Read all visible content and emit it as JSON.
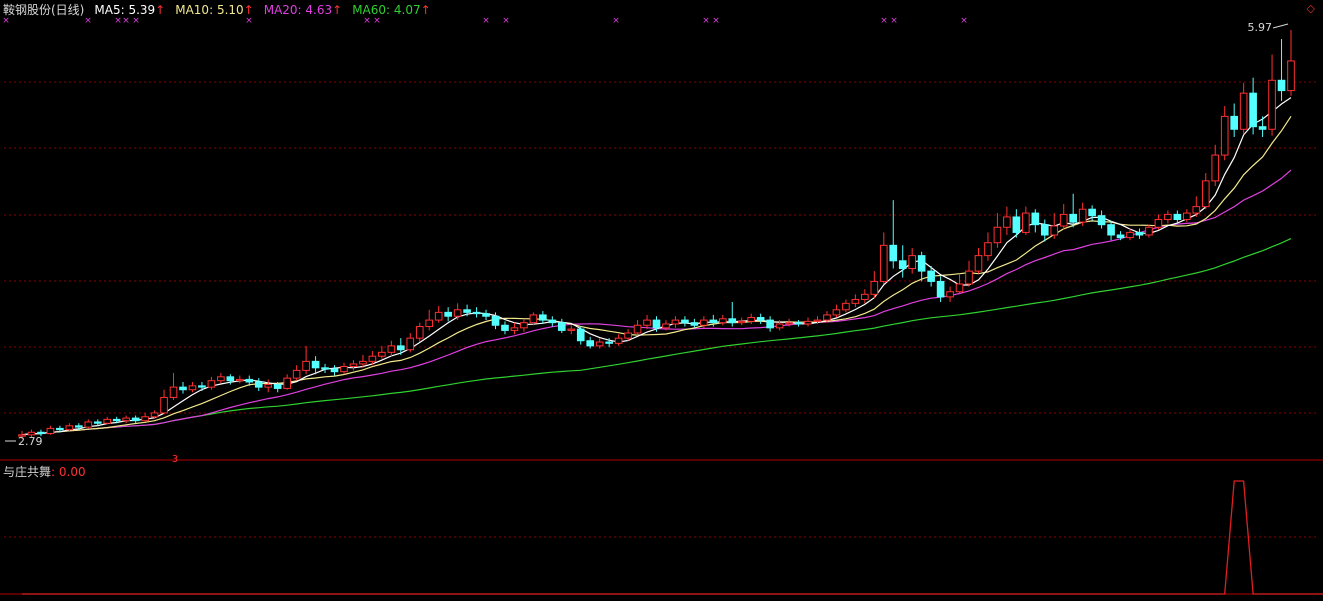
{
  "header": {
    "title": "鞍钢股份(日线)",
    "ma5": {
      "label": "MA5:",
      "value": "5.39",
      "arrow": "↑",
      "color": "#ffffff"
    },
    "ma10": {
      "label": "MA10:",
      "value": "5.10",
      "arrow": "↑",
      "color": "#f2e88c"
    },
    "ma20": {
      "label": "MA20:",
      "value": "4.63",
      "arrow": "↑",
      "color": "#e040e0"
    },
    "ma60": {
      "label": "MA60:",
      "value": "4.07",
      "arrow": "↑",
      "color": "#30d030"
    },
    "arrow_color": "#ff3030",
    "corner_icon": "diamond-icon"
  },
  "indicator": {
    "label": "与庄共舞",
    "value": ": 0.00",
    "label_color": "#d0d0d0",
    "value_color": "#ff3030"
  },
  "annotations": {
    "high_label": "5.97",
    "low_label": "2.79",
    "signal_marker": "3",
    "top_marker": "×"
  },
  "colors": {
    "up": "#ff3030",
    "down": "#54ffff",
    "grid": "#8b0000",
    "marker": "#e040e0"
  },
  "chart_data": [
    {
      "type": "candlestick",
      "title": "鞍钢股份(日线)",
      "price_range": [
        2.79,
        5.97
      ],
      "grid": "dotted horizontal",
      "legend": "top-left",
      "high": 5.97,
      "low": 2.79,
      "candles": [
        [
          2.82,
          2.83,
          2.8,
          2.86
        ],
        [
          2.83,
          2.85,
          2.81,
          2.87
        ],
        [
          2.85,
          2.84,
          2.82,
          2.87
        ],
        [
          2.84,
          2.88,
          2.83,
          2.9
        ],
        [
          2.88,
          2.87,
          2.85,
          2.9
        ],
        [
          2.87,
          2.9,
          2.86,
          2.92
        ],
        [
          2.9,
          2.89,
          2.87,
          2.92
        ],
        [
          2.89,
          2.93,
          2.88,
          2.95
        ],
        [
          2.93,
          2.92,
          2.9,
          2.95
        ],
        [
          2.92,
          2.95,
          2.91,
          2.97
        ],
        [
          2.95,
          2.94,
          2.92,
          2.97
        ],
        [
          2.94,
          2.96,
          2.92,
          2.98
        ],
        [
          2.96,
          2.94,
          2.92,
          2.98
        ],
        [
          2.94,
          2.97,
          2.93,
          3.0
        ],
        [
          2.97,
          3.0,
          2.96,
          3.02
        ],
        [
          3.0,
          3.12,
          2.99,
          3.18
        ],
        [
          3.12,
          3.2,
          3.1,
          3.31
        ],
        [
          3.2,
          3.18,
          3.15,
          3.24
        ],
        [
          3.18,
          3.21,
          3.16,
          3.24
        ],
        [
          3.21,
          3.2,
          3.17,
          3.24
        ],
        [
          3.2,
          3.25,
          3.18,
          3.28
        ],
        [
          3.25,
          3.28,
          3.23,
          3.31
        ],
        [
          3.28,
          3.25,
          3.22,
          3.3
        ],
        [
          3.25,
          3.26,
          3.23,
          3.29
        ],
        [
          3.26,
          3.24,
          3.21,
          3.29
        ],
        [
          3.24,
          3.2,
          3.17,
          3.27
        ],
        [
          3.2,
          3.22,
          3.16,
          3.26
        ],
        [
          3.22,
          3.19,
          3.16,
          3.24
        ],
        [
          3.19,
          3.27,
          3.18,
          3.3
        ],
        [
          3.27,
          3.33,
          3.25,
          3.37
        ],
        [
          3.33,
          3.4,
          3.3,
          3.52
        ],
        [
          3.4,
          3.35,
          3.3,
          3.44
        ],
        [
          3.35,
          3.34,
          3.31,
          3.38
        ],
        [
          3.34,
          3.32,
          3.29,
          3.37
        ],
        [
          3.32,
          3.36,
          3.3,
          3.39
        ],
        [
          3.36,
          3.38,
          3.33,
          3.41
        ],
        [
          3.38,
          3.4,
          3.35,
          3.45
        ],
        [
          3.4,
          3.44,
          3.37,
          3.48
        ],
        [
          3.44,
          3.47,
          3.42,
          3.52
        ],
        [
          3.47,
          3.52,
          3.44,
          3.56
        ],
        [
          3.52,
          3.49,
          3.45,
          3.58
        ],
        [
          3.49,
          3.58,
          3.47,
          3.62
        ],
        [
          3.58,
          3.67,
          3.55,
          3.7
        ],
        [
          3.67,
          3.72,
          3.64,
          3.8
        ],
        [
          3.72,
          3.78,
          3.7,
          3.83
        ],
        [
          3.78,
          3.75,
          3.71,
          3.82
        ],
        [
          3.75,
          3.8,
          3.72,
          3.85
        ],
        [
          3.8,
          3.78,
          3.75,
          3.84
        ],
        [
          3.78,
          3.77,
          3.74,
          3.82
        ],
        [
          3.77,
          3.75,
          3.72,
          3.8
        ],
        [
          3.75,
          3.68,
          3.65,
          3.78
        ],
        [
          3.68,
          3.64,
          3.61,
          3.71
        ],
        [
          3.64,
          3.66,
          3.61,
          3.7
        ],
        [
          3.66,
          3.7,
          3.63,
          3.73
        ],
        [
          3.7,
          3.76,
          3.68,
          3.78
        ],
        [
          3.76,
          3.72,
          3.69,
          3.79
        ],
        [
          3.72,
          3.7,
          3.67,
          3.75
        ],
        [
          3.7,
          3.64,
          3.62,
          3.73
        ],
        [
          3.64,
          3.65,
          3.61,
          3.68
        ],
        [
          3.65,
          3.56,
          3.53,
          3.67
        ],
        [
          3.56,
          3.52,
          3.5,
          3.59
        ],
        [
          3.52,
          3.55,
          3.5,
          3.58
        ],
        [
          3.55,
          3.54,
          3.51,
          3.58
        ],
        [
          3.54,
          3.58,
          3.52,
          3.61
        ],
        [
          3.58,
          3.62,
          3.56,
          3.65
        ],
        [
          3.62,
          3.68,
          3.6,
          3.72
        ],
        [
          3.68,
          3.72,
          3.65,
          3.76
        ],
        [
          3.72,
          3.66,
          3.63,
          3.75
        ],
        [
          3.66,
          3.69,
          3.64,
          3.72
        ],
        [
          3.69,
          3.72,
          3.66,
          3.75
        ],
        [
          3.72,
          3.7,
          3.67,
          3.75
        ],
        [
          3.7,
          3.68,
          3.66,
          3.73
        ],
        [
          3.68,
          3.72,
          3.66,
          3.75
        ],
        [
          3.72,
          3.7,
          3.67,
          3.76
        ],
        [
          3.7,
          3.73,
          3.68,
          3.76
        ],
        [
          3.73,
          3.7,
          3.67,
          3.86
        ],
        [
          3.7,
          3.71,
          3.68,
          3.74
        ],
        [
          3.71,
          3.74,
          3.69,
          3.77
        ],
        [
          3.74,
          3.72,
          3.69,
          3.77
        ],
        [
          3.72,
          3.66,
          3.63,
          3.75
        ],
        [
          3.66,
          3.69,
          3.64,
          3.72
        ],
        [
          3.69,
          3.7,
          3.67,
          3.73
        ],
        [
          3.7,
          3.69,
          3.67,
          3.72
        ],
        [
          3.69,
          3.71,
          3.67,
          3.74
        ],
        [
          3.71,
          3.72,
          3.69,
          3.75
        ],
        [
          3.72,
          3.76,
          3.7,
          3.79
        ],
        [
          3.76,
          3.8,
          3.74,
          3.84
        ],
        [
          3.8,
          3.85,
          3.78,
          3.88
        ],
        [
          3.85,
          3.88,
          3.82,
          3.92
        ],
        [
          3.88,
          3.92,
          3.85,
          3.96
        ],
        [
          3.92,
          4.02,
          3.89,
          4.1
        ],
        [
          4.02,
          4.3,
          4.0,
          4.4
        ],
        [
          4.3,
          4.18,
          4.12,
          4.65
        ],
        [
          4.18,
          4.12,
          4.05,
          4.3
        ],
        [
          4.12,
          4.22,
          4.08,
          4.28
        ],
        [
          4.22,
          4.1,
          4.02,
          4.25
        ],
        [
          4.1,
          4.02,
          3.98,
          4.14
        ],
        [
          4.02,
          3.9,
          3.86,
          4.06
        ],
        [
          3.9,
          3.94,
          3.86,
          3.98
        ],
        [
          3.94,
          4.0,
          3.92,
          4.08
        ],
        [
          4.0,
          4.1,
          3.98,
          4.18
        ],
        [
          4.1,
          4.22,
          4.08,
          4.28
        ],
        [
          4.22,
          4.32,
          4.18,
          4.4
        ],
        [
          4.32,
          4.44,
          4.28,
          4.55
        ],
        [
          4.44,
          4.52,
          4.38,
          4.6
        ],
        [
          4.52,
          4.4,
          4.36,
          4.58
        ],
        [
          4.4,
          4.55,
          4.38,
          4.6
        ],
        [
          4.55,
          4.46,
          4.4,
          4.58
        ],
        [
          4.46,
          4.38,
          4.33,
          4.5
        ],
        [
          4.38,
          4.45,
          4.35,
          4.55
        ],
        [
          4.45,
          4.54,
          4.42,
          4.62
        ],
        [
          4.54,
          4.48,
          4.44,
          4.7
        ],
        [
          4.48,
          4.58,
          4.45,
          4.63
        ],
        [
          4.58,
          4.53,
          4.49,
          4.61
        ],
        [
          4.53,
          4.46,
          4.43,
          4.57
        ],
        [
          4.46,
          4.38,
          4.34,
          4.49
        ],
        [
          4.38,
          4.36,
          4.34,
          4.41
        ],
        [
          4.36,
          4.4,
          4.34,
          4.43
        ],
        [
          4.4,
          4.38,
          4.35,
          4.43
        ],
        [
          4.38,
          4.44,
          4.36,
          4.46
        ],
        [
          4.44,
          4.5,
          4.42,
          4.54
        ],
        [
          4.5,
          4.54,
          4.47,
          4.57
        ],
        [
          4.54,
          4.5,
          4.47,
          4.57
        ],
        [
          4.5,
          4.55,
          4.48,
          4.58
        ],
        [
          4.55,
          4.6,
          4.52,
          4.68
        ],
        [
          4.6,
          4.8,
          4.58,
          4.86
        ],
        [
          4.8,
          5.0,
          4.76,
          5.08
        ],
        [
          5.0,
          5.3,
          4.96,
          5.38
        ],
        [
          5.3,
          5.2,
          5.14,
          5.4
        ],
        [
          5.2,
          5.48,
          5.16,
          5.56
        ],
        [
          5.48,
          5.22,
          5.16,
          5.6
        ],
        [
          5.22,
          5.2,
          5.14,
          5.3
        ],
        [
          5.2,
          5.58,
          5.15,
          5.78
        ],
        [
          5.58,
          5.5,
          5.42,
          5.9
        ],
        [
          5.5,
          5.73,
          5.46,
          5.97
        ]
      ]
    },
    {
      "type": "line",
      "title": "与庄共舞",
      "series": [
        {
          "name": "与庄共舞",
          "x": [
            0,
            126,
            127,
            128,
            129,
            130,
            131,
            132,
            139
          ],
          "values": [
            0,
            0,
            0,
            1,
            1,
            0,
            0,
            0,
            0
          ]
        }
      ],
      "ylim": [
        0,
        1
      ]
    }
  ]
}
